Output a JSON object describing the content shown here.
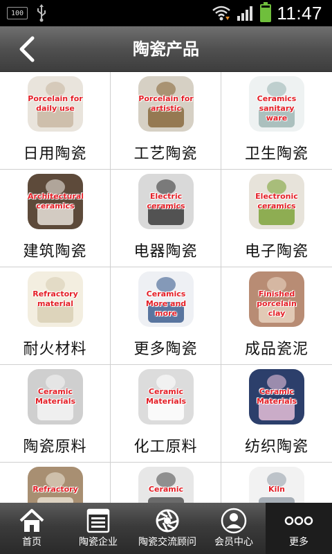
{
  "status_bar": {
    "battery_small": "100",
    "time": "11:47",
    "battery_level": 0.85
  },
  "header": {
    "title": "陶瓷产品"
  },
  "products": [
    {
      "label": "日用陶瓷",
      "caption": "Porcelain for daily use",
      "bg": "#e9e4dc",
      "accent": "#c9b9a3"
    },
    {
      "label": "工艺陶瓷",
      "caption": "Porcelain for artistic",
      "bg": "#d6d0c4",
      "accent": "#8a6a3e"
    },
    {
      "label": "卫生陶瓷",
      "caption": "Ceramics sanitary ware",
      "bg": "#eef2f2",
      "accent": "#9fb7b5"
    },
    {
      "label": "建筑陶瓷",
      "caption": "Architectural ceramics",
      "bg": "#5d4a3a",
      "accent": "#e8e2da"
    },
    {
      "label": "电器陶瓷",
      "caption": "Electric ceramics",
      "bg": "#d9d9d9",
      "accent": "#3a3a3a"
    },
    {
      "label": "电子陶瓷",
      "caption": "Electronic ceramics",
      "bg": "#e7e3da",
      "accent": "#7ea33a"
    },
    {
      "label": "耐火材料",
      "caption": "Refractory material",
      "bg": "#f3eee0",
      "accent": "#d8cfb4"
    },
    {
      "label": "更多陶瓷",
      "caption": "Ceramics More and more",
      "bg": "#eef0f4",
      "accent": "#3e5f8f"
    },
    {
      "label": "成品瓷泥",
      "caption": "Finished porcelain clay",
      "bg": "#b88c74",
      "accent": "#e7d3c1"
    },
    {
      "label": "陶瓷原料",
      "caption": "Ceramic Materials",
      "bg": "#cfcfcf",
      "accent": "#f4f4f4"
    },
    {
      "label": "化工原料",
      "caption": "Ceramic Materials",
      "bg": "#dcdcdc",
      "accent": "#ffffff"
    },
    {
      "label": "纺织陶瓷",
      "caption": "Ceramic Materials",
      "bg": "#2c3f6b",
      "accent": "#e6c0d8"
    },
    {
      "label": "",
      "caption": "Refractory",
      "bg": "#a88f72",
      "accent": "#e8dfd0"
    },
    {
      "label": "",
      "caption": "Ceramic",
      "bg": "#e7e7e7",
      "accent": "#555555"
    },
    {
      "label": "",
      "caption": "Kiln",
      "bg": "#f2f2f2",
      "accent": "#9aa3ad"
    }
  ],
  "bottom_nav": [
    {
      "label": "首页",
      "icon": "home-icon"
    },
    {
      "label": "陶瓷企业",
      "icon": "list-icon"
    },
    {
      "label": "陶瓷交流顾问",
      "icon": "aperture-icon"
    },
    {
      "label": "会员中心",
      "icon": "user-icon"
    },
    {
      "label": "更多",
      "icon": "more-icon"
    }
  ],
  "colors": {
    "caption_red": "#e41e26",
    "header_bg": "#505050",
    "nav_active_bg": "#1d1d1d",
    "battery_green": "#6fbf3c"
  }
}
